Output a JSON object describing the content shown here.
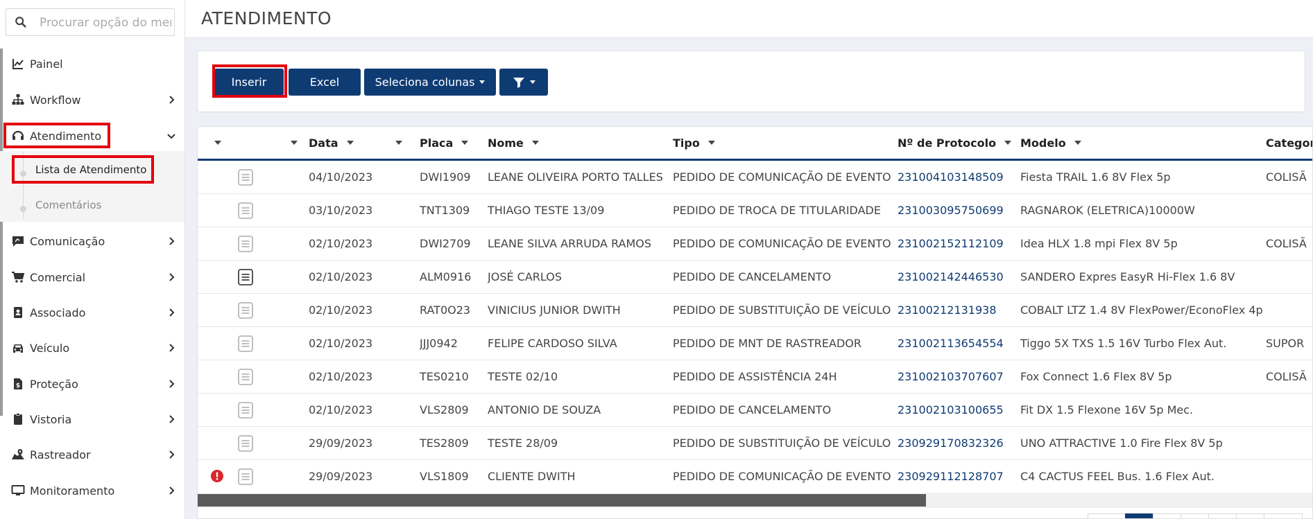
{
  "search": {
    "placeholder": "Procurar opção do menu"
  },
  "sidebar": {
    "items": [
      {
        "label": "Painel",
        "icon": "chart-line-icon",
        "has_chevron": false
      },
      {
        "label": "Workflow",
        "icon": "sitemap-icon",
        "has_chevron": true
      },
      {
        "label": "Atendimento",
        "icon": "headset-icon",
        "has_chevron": true,
        "expanded": true
      },
      {
        "label": "Comunicação",
        "icon": "comment-icon",
        "has_chevron": true
      },
      {
        "label": "Comercial",
        "icon": "cart-icon",
        "has_chevron": true
      },
      {
        "label": "Associado",
        "icon": "id-card-icon",
        "has_chevron": true
      },
      {
        "label": "Veículo",
        "icon": "car-icon",
        "has_chevron": true
      },
      {
        "label": "Proteção",
        "icon": "file-dollar-icon",
        "has_chevron": true
      },
      {
        "label": "Vistoria",
        "icon": "clipboard-icon",
        "has_chevron": true
      },
      {
        "label": "Rastreador",
        "icon": "map-marker-icon",
        "has_chevron": true
      },
      {
        "label": "Monitoramento",
        "icon": "monitor-icon",
        "has_chevron": true
      }
    ],
    "submenu": [
      {
        "label": "Lista de Atendimento",
        "active": true
      },
      {
        "label": "Comentários",
        "active": false
      }
    ]
  },
  "header": {
    "title": "ATENDIMENTO"
  },
  "toolbar": {
    "insert_label": "Inserir",
    "excel_label": "Excel",
    "columns_label": "Seleciona colunas"
  },
  "table": {
    "columns": [
      "Data",
      "Placa",
      "Nome",
      "Tipo",
      "Nº de Protocolo",
      "Modelo",
      "Categor"
    ],
    "rows": [
      {
        "alert": false,
        "doc_dark": false,
        "data": "04/10/2023",
        "placa": "DWI1909",
        "nome": "LEANE OLIVEIRA PORTO TALLES",
        "tipo": "PEDIDO DE COMUNICAÇÃO DE EVENTO",
        "protocolo": "231004103148509",
        "modelo": "Fiesta TRAIL 1.6 8V Flex 5p",
        "categoria": "COLISÃ"
      },
      {
        "alert": false,
        "doc_dark": false,
        "data": "03/10/2023",
        "placa": "TNT1309",
        "nome": "THIAGO TESTE 13/09",
        "tipo": "PEDIDO DE TROCA DE TITULARIDADE",
        "protocolo": "231003095750699",
        "modelo": "RAGNAROK (ELETRICA)10000W",
        "categoria": ""
      },
      {
        "alert": false,
        "doc_dark": false,
        "data": "02/10/2023",
        "placa": "DWI2709",
        "nome": "LEANE SILVA ARRUDA RAMOS",
        "tipo": "PEDIDO DE COMUNICAÇÃO DE EVENTO",
        "protocolo": "231002152112109",
        "modelo": "Idea HLX 1.8 mpi Flex 8V 5p",
        "categoria": "COLISÃ"
      },
      {
        "alert": false,
        "doc_dark": true,
        "data": "02/10/2023",
        "placa": "ALM0916",
        "nome": "JOSÉ CARLOS",
        "tipo": "PEDIDO DE CANCELAMENTO",
        "protocolo": "231002142446530",
        "modelo": "SANDERO Expres EasyR Hi-Flex 1.6 8V",
        "categoria": ""
      },
      {
        "alert": false,
        "doc_dark": false,
        "data": "02/10/2023",
        "placa": "RAT0O23",
        "nome": "VINICIUS JUNIOR DWITH",
        "tipo": "PEDIDO DE SUBSTITUIÇÃO DE VEÍCULO",
        "protocolo": "23100212131938",
        "modelo": "COBALT LTZ 1.4 8V FlexPower/EconoFlex 4p",
        "categoria": ""
      },
      {
        "alert": false,
        "doc_dark": false,
        "data": "02/10/2023",
        "placa": "JJJ0942",
        "nome": "FELIPE CARDOSO SILVA",
        "tipo": "PEDIDO DE MNT DE RASTREADOR",
        "protocolo": "231002113654554",
        "modelo": "Tiggo 5X TXS 1.5 16V Turbo Flex Aut.",
        "categoria": "SUPOR"
      },
      {
        "alert": false,
        "doc_dark": false,
        "data": "02/10/2023",
        "placa": "TES0210",
        "nome": "TESTE 02/10",
        "tipo": "PEDIDO DE ASSISTÊNCIA 24H",
        "protocolo": "231002103707607",
        "modelo": "Fox Connect 1.6 Flex 8V 5p",
        "categoria": "COLISÃ"
      },
      {
        "alert": false,
        "doc_dark": false,
        "data": "02/10/2023",
        "placa": "VLS2809",
        "nome": "ANTONIO DE SOUZA",
        "tipo": "PEDIDO DE CANCELAMENTO",
        "protocolo": "231002103100655",
        "modelo": "Fit DX 1.5 Flexone 16V 5p Mec.",
        "categoria": ""
      },
      {
        "alert": false,
        "doc_dark": false,
        "data": "29/09/2023",
        "placa": "TES2809",
        "nome": "TESTE 28/09",
        "tipo": "PEDIDO DE SUBSTITUIÇÃO DE VEÍCULO",
        "protocolo": "230929170832326",
        "modelo": "UNO ATTRACTIVE 1.0 Fire Flex 8V 5p",
        "categoria": ""
      },
      {
        "alert": true,
        "doc_dark": false,
        "data": "29/09/2023",
        "placa": "VLS1809",
        "nome": "CLIENTE DWITH",
        "tipo": "PEDIDO DE COMUNICAÇÃO DE EVENTO",
        "protocolo": "230929112128707",
        "modelo": "C4 CACTUS FEEL Bus. 1.6 Flex Aut.",
        "categoria": ""
      }
    ]
  },
  "colors": {
    "primary": "#0f3b73",
    "highlight": "#e3000f",
    "alert": "#d9262c"
  }
}
